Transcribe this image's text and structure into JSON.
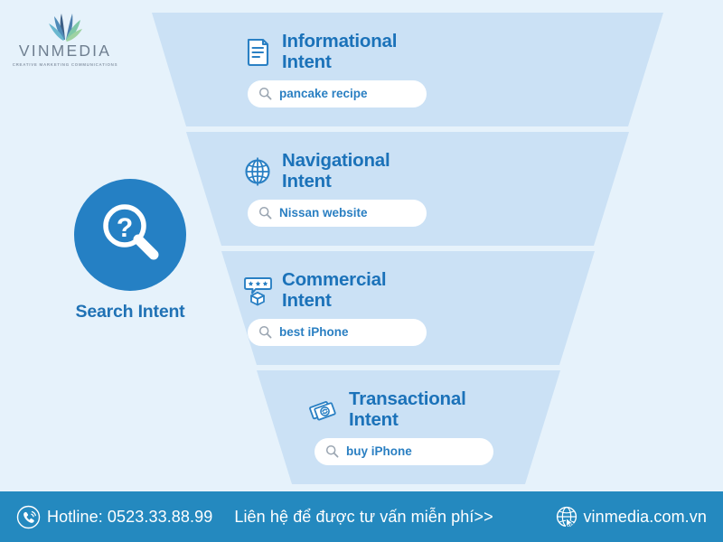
{
  "brand": {
    "wordmark": "VINMEDIA",
    "tagline": "CREATIVE MARKETING COMMUNICATIONS",
    "logo_icon": "leaf-plant-icon"
  },
  "badge": {
    "label": "Search Intent",
    "icon": "magnifier-question-icon",
    "circle_color": "#2580c4",
    "label_color": "#2072b5"
  },
  "colors": {
    "page_background": "#e6f2fb",
    "funnel_fill": "#cbe1f5",
    "accent_blue": "#1b72b9",
    "footer_bar": "#2489bf",
    "search_box": "#ffffff"
  },
  "funnel": {
    "segments": [
      {
        "title": "Informational\nIntent",
        "icon": "document-lines-icon",
        "query": "pancake recipe",
        "search_icon": "search-icon"
      },
      {
        "title": "Navigational\nIntent",
        "icon": "globe-icon",
        "query": "Nissan website",
        "search_icon": "search-icon"
      },
      {
        "title": "Commercial\nIntent",
        "icon": "box-star-rating-icon",
        "query": "best iPhone",
        "search_icon": "search-icon"
      },
      {
        "title": "Transactional\nIntent",
        "icon": "banknotes-exchange-icon",
        "query": "buy iPhone",
        "search_icon": "search-icon"
      }
    ]
  },
  "footer": {
    "phone_icon": "phone-call-icon",
    "hotline": "Hotline: 0523.33.88.99",
    "cta": "Liên hệ để được tư vấn miễn phí>>",
    "globe_icon": "globe-cursor-icon",
    "website": "vinmedia.com.vn"
  }
}
